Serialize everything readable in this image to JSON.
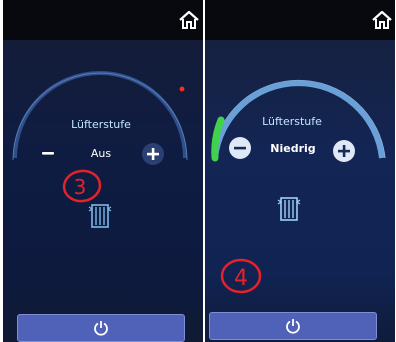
{
  "screens": [
    {
      "title": "Lüfterstufe",
      "value": "Aus",
      "annotation": "3",
      "gauge_level": 0
    },
    {
      "title": "Lüfterstufe",
      "value": "Niedrig",
      "annotation": "4",
      "gauge_level": 0.12
    }
  ],
  "icons": {
    "home": "home-icon",
    "minus": "minus-icon",
    "plus": "plus-icon",
    "fan": "fan-level-icon",
    "power": "power-icon"
  },
  "colors": {
    "gauge_arc": "#6aa0d8",
    "gauge_active": "#3fd24a",
    "power_button": "#4f62b8",
    "annotation": "#e5222a"
  }
}
